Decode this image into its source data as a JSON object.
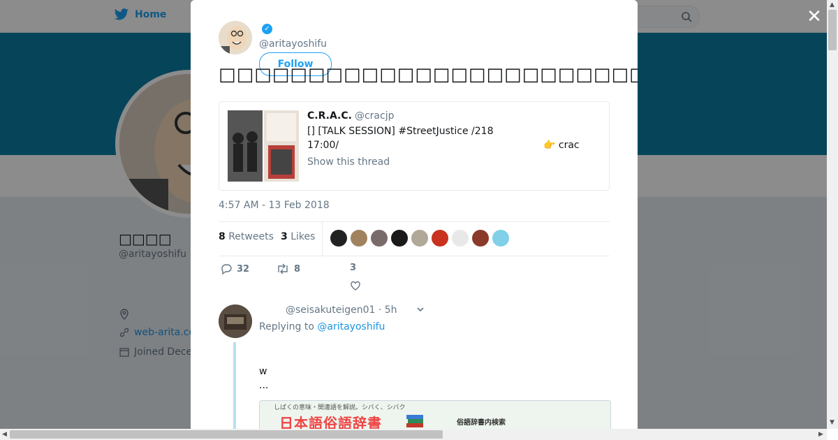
{
  "topnav": {
    "home_label": "Home"
  },
  "profile": {
    "name": "□□□□",
    "handle": "@aritayoshifu",
    "link": "web-arita.co",
    "joined": "Joined Dece"
  },
  "tweet": {
    "handle": "@aritayoshifu",
    "follow_label": "Follow",
    "text": "□□□□□□□□□□□□□□□□□□□□□□□□□□□□□□□□□□□□□□□□□□□□□□□□□□□□",
    "quote": {
      "name": "C.R.A.C.",
      "handle": "@cracjp",
      "line1": "[] [TALK SESSION]         #StreetJustice /218",
      "line2": "17:00/",
      "extra": "👉       crac",
      "show_thread": "Show this thread"
    },
    "timestamp": "4:57 AM - 13 Feb 2018",
    "retweets_count": "8",
    "retweets_label": "Retweets",
    "likes_count": "3",
    "likes_label": "Likes",
    "actions": {
      "replies": "32",
      "retweets": "8",
      "likes": "3"
    }
  },
  "reply": {
    "handle": "@seisakuteigen01",
    "time": "· 5h",
    "replying_to_label": "Replying to",
    "replying_to_handle": "@aritayoshifu",
    "text_line1": "w",
    "text_line2": "...",
    "card_top_text": "しばくの意味・関連語を解説。シバく、シバク",
    "card_logo_text": "日本語俗語辞書",
    "card_side_text": "俗語辞書内検索"
  },
  "liker_colors": [
    "#222222",
    "#a0825f",
    "#7a6b6b",
    "#1a1a1a",
    "#b0a898",
    "#c8321e",
    "#e8e8e8",
    "#8b3a2a",
    "#7fd0e8"
  ]
}
